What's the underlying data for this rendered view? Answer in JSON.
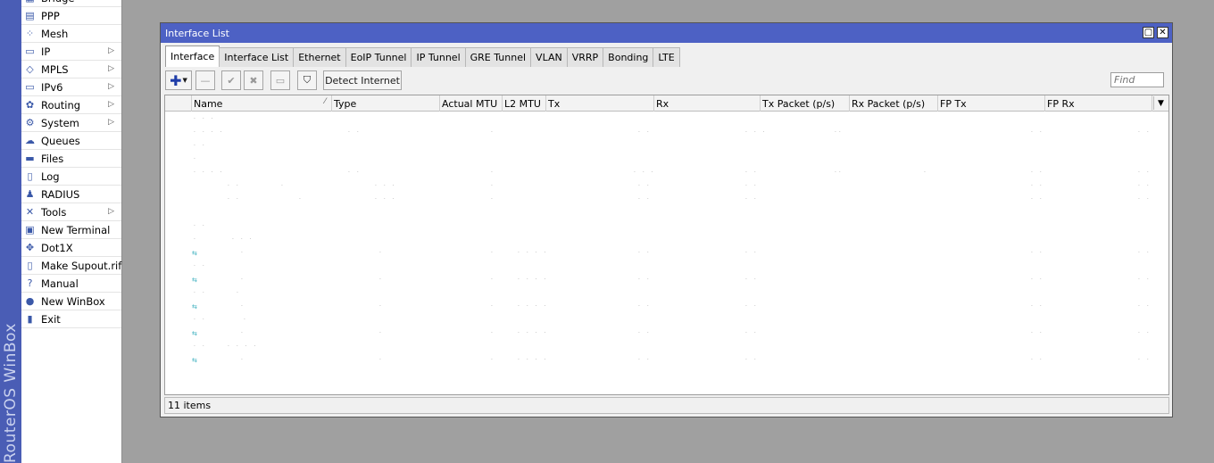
{
  "brand": "RouterOS WinBox",
  "sidebar": {
    "items": [
      {
        "label": "Bridge",
        "icon": "bridge-icon",
        "glyph": "▦",
        "arrow": false
      },
      {
        "label": "PPP",
        "icon": "ppp-icon",
        "glyph": "▤",
        "arrow": false
      },
      {
        "label": "Mesh",
        "icon": "mesh-icon",
        "glyph": "⁘",
        "arrow": false
      },
      {
        "label": "IP",
        "icon": "ip-icon",
        "glyph": "▭",
        "arrow": true
      },
      {
        "label": "MPLS",
        "icon": "mpls-icon",
        "glyph": "◇",
        "arrow": true
      },
      {
        "label": "IPv6",
        "icon": "ipv6-icon",
        "glyph": "▭",
        "arrow": true
      },
      {
        "label": "Routing",
        "icon": "routing-icon",
        "glyph": "✿",
        "arrow": true
      },
      {
        "label": "System",
        "icon": "system-icon",
        "glyph": "⚙",
        "arrow": true
      },
      {
        "label": "Queues",
        "icon": "queues-icon",
        "glyph": "☁",
        "arrow": false
      },
      {
        "label": "Files",
        "icon": "files-icon",
        "glyph": "▬",
        "arrow": false
      },
      {
        "label": "Log",
        "icon": "log-icon",
        "glyph": "▯",
        "arrow": false
      },
      {
        "label": "RADIUS",
        "icon": "radius-icon",
        "glyph": "♟",
        "arrow": false
      },
      {
        "label": "Tools",
        "icon": "tools-icon",
        "glyph": "✕",
        "arrow": true
      },
      {
        "label": "New Terminal",
        "icon": "terminal-icon",
        "glyph": "▣",
        "arrow": false
      },
      {
        "label": "Dot1X",
        "icon": "dot1x-icon",
        "glyph": "✥",
        "arrow": false
      },
      {
        "label": "Make Supout.rif",
        "icon": "supout-icon",
        "glyph": "▯",
        "arrow": false
      },
      {
        "label": "Manual",
        "icon": "manual-icon",
        "glyph": "?",
        "arrow": false
      },
      {
        "label": "New WinBox",
        "icon": "winbox-icon",
        "glyph": "●",
        "arrow": false
      },
      {
        "label": "Exit",
        "icon": "exit-icon",
        "glyph": "▮",
        "arrow": false
      }
    ]
  },
  "window": {
    "title": "Interface List",
    "tabs": [
      "Interface",
      "Interface List",
      "Ethernet",
      "EoIP Tunnel",
      "IP Tunnel",
      "GRE Tunnel",
      "VLAN",
      "VRRP",
      "Bonding",
      "LTE"
    ],
    "active_tab": "Interface",
    "toolbar": {
      "detect_internet": "Detect Internet",
      "find_placeholder": "Find"
    },
    "columns": [
      "Name",
      "Type",
      "Actual MTU",
      "L2 MTU",
      "Tx",
      "Rx",
      "Tx Packet (p/s)",
      "Rx Packet (p/s)",
      "FP Tx",
      "FP Rx"
    ],
    "status": "11 items"
  },
  "colors": {
    "titlebar": "#4d61c4",
    "brand_strip": "#4a5db5",
    "link": "#44b3c2"
  }
}
